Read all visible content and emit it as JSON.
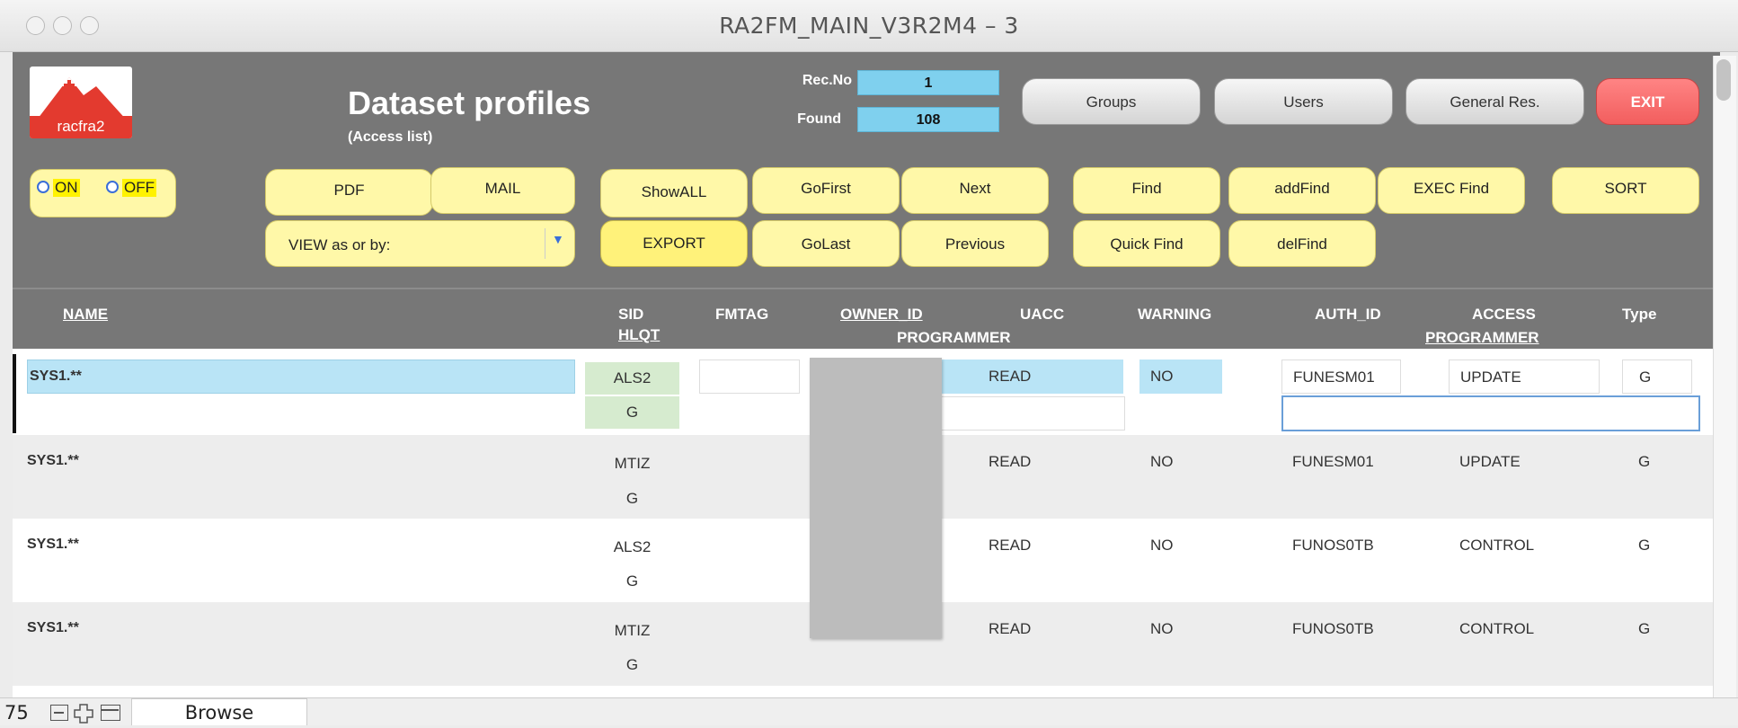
{
  "window": {
    "title": "RA2FM_MAIN_V3R2M4 – 3"
  },
  "header": {
    "logo_text": "racfra2",
    "title": "Dataset profiles",
    "subtitle": "(Access list)",
    "recno_label": "Rec.No",
    "recno_value": "1",
    "found_label": "Found",
    "found_value": "108",
    "nav_buttons": {
      "groups": "Groups",
      "users": "Users",
      "general": "General Res.",
      "exit": "EXIT"
    },
    "toggle": {
      "on": "ON",
      "off": "OFF"
    },
    "buttons": {
      "pdf": "PDF",
      "mail": "MAIL",
      "showall": "ShowALL",
      "gofirst": "GoFirst",
      "next": "Next",
      "find": "Find",
      "addfind": "addFind",
      "execfind": "EXEC Find",
      "sort": "SORT",
      "export": "EXPORT",
      "golast": "GoLast",
      "previous": "Previous",
      "quickfind": "Quick Find",
      "delfind": "delFind"
    },
    "view_select": "VIEW as or by:"
  },
  "columns": {
    "name": "NAME",
    "sid": "SID",
    "hlqt": "HLQT",
    "fmtag": "FMTAG",
    "owner_id": "OWNER_ID",
    "programmer1": "PROGRAMMER",
    "uacc": "UACC",
    "warning": "WARNING",
    "auth_id": "AUTH_ID",
    "access": "ACCESS",
    "programmer2": "PROGRAMMER",
    "type": "Type"
  },
  "rows": [
    {
      "name": "SYS1.**",
      "sid": "ALS2",
      "hlqt": "G",
      "uacc": "READ",
      "warning": "NO",
      "auth_id": "FUNESM01",
      "access": "UPDATE",
      "type": "G"
    },
    {
      "name": "SYS1.**",
      "sid": "MTIZ",
      "hlqt": "G",
      "uacc": "READ",
      "warning": "NO",
      "auth_id": "FUNESM01",
      "access": "UPDATE",
      "type": "G"
    },
    {
      "name": "SYS1.**",
      "sid": "ALS2",
      "hlqt": "G",
      "uacc": "READ",
      "warning": "NO",
      "auth_id": "FUNOS0TB",
      "access": "CONTROL",
      "type": "G"
    },
    {
      "name": "SYS1.**",
      "sid": "MTIZ",
      "hlqt": "G",
      "uacc": "READ",
      "warning": "NO",
      "auth_id": "FUNOS0TB",
      "access": "CONTROL",
      "type": "G"
    }
  ],
  "status": {
    "zoom": "75",
    "mode": "Browse"
  },
  "colors": {
    "header_bg": "#777777",
    "selected_row": "#b9e4f6",
    "button_yellow": "#fff8a8",
    "exit_red": "#f25e5e"
  }
}
